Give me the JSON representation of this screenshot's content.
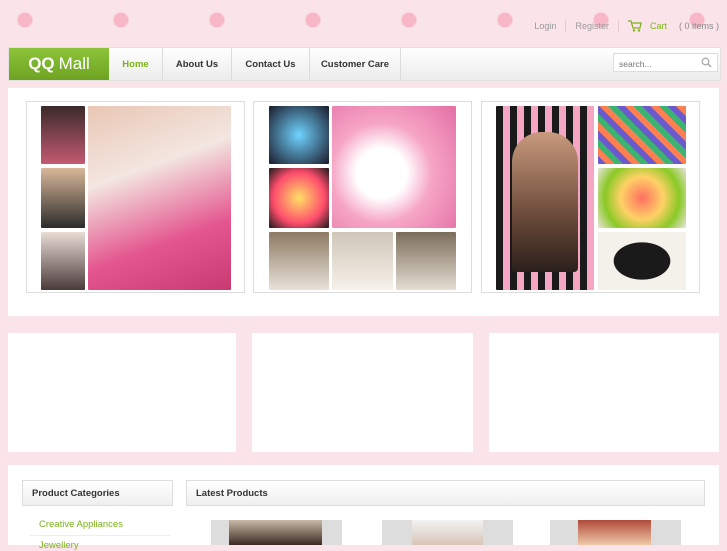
{
  "header": {
    "login": "Login",
    "register": "Register",
    "cart_label": "Cart",
    "cart_count": "( 0 items )"
  },
  "brand": {
    "logo_part1": "QQ",
    "logo_part2": "Mall",
    "accent": "#7bb21a"
  },
  "nav": {
    "items": [
      {
        "label": "Home",
        "active": true
      },
      {
        "label": "About Us",
        "active": false
      },
      {
        "label": "Contact Us",
        "active": false
      },
      {
        "label": "Customer Care",
        "active": false
      }
    ]
  },
  "search": {
    "placeholder": "search...",
    "icon": "search-icon"
  },
  "sidebar": {
    "title": "Product Categories",
    "categories": [
      "Creative Appliances",
      "Jewellery"
    ]
  },
  "main": {
    "latest_title": "Latest Products"
  },
  "colors": {
    "page_bg": "#fbe3ea",
    "accent_green": "#7bb21a",
    "logo_green": "#8cc43a"
  }
}
